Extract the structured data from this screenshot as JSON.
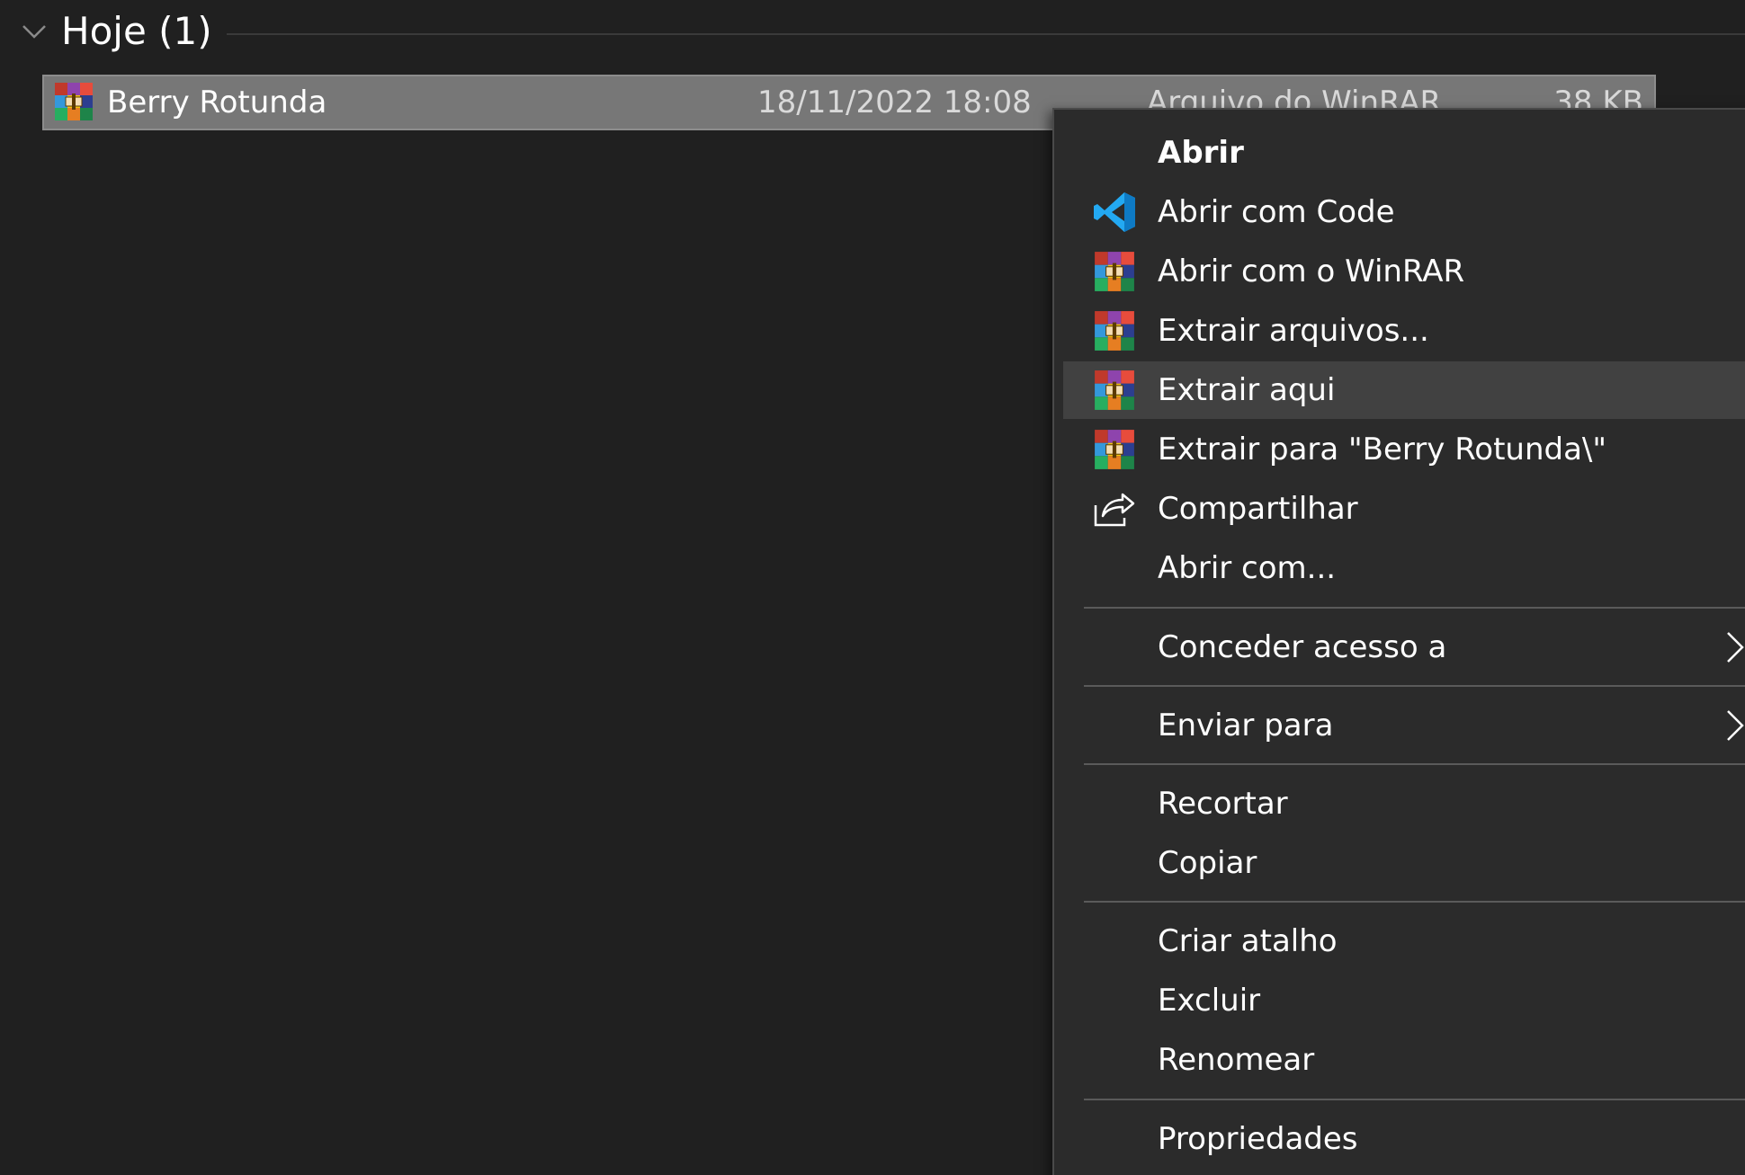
{
  "group": {
    "title": "Hoje (1)"
  },
  "file": {
    "name": "Berry Rotunda",
    "modified": "18/11/2022 18:08",
    "type": "Arquivo do WinRAR",
    "size": "38 KB",
    "icon": "winrar-archive-icon"
  },
  "menu": {
    "items": [
      {
        "label": "Abrir",
        "icon": "",
        "bold": true
      },
      {
        "label": "Abrir com Code",
        "icon": "vscode-icon"
      },
      {
        "label": "Abrir com o WinRAR",
        "icon": "winrar-icon"
      },
      {
        "label": "Extrair arquivos...",
        "icon": "winrar-icon"
      },
      {
        "label": "Extrair aqui",
        "icon": "winrar-icon",
        "hovered": true
      },
      {
        "label": "Extrair para \"Berry Rotunda\\\"",
        "icon": "winrar-icon"
      },
      {
        "label": "Compartilhar",
        "icon": "share-icon"
      },
      {
        "label": "Abrir com...",
        "icon": ""
      },
      {
        "label": "Conceder acesso a",
        "icon": "",
        "submenu": true
      },
      {
        "label": "Enviar para",
        "icon": "",
        "submenu": true
      },
      {
        "label": "Recortar",
        "icon": ""
      },
      {
        "label": "Copiar",
        "icon": ""
      },
      {
        "label": "Criar atalho",
        "icon": ""
      },
      {
        "label": "Excluir",
        "icon": ""
      },
      {
        "label": "Renomear",
        "icon": ""
      },
      {
        "label": "Propriedades",
        "icon": ""
      }
    ]
  },
  "colors": {
    "background": "#202020",
    "menu_background": "#2b2b2b",
    "menu_hover": "#414141",
    "selected_row": "#777777",
    "vscode_blue": "#23a9f2"
  }
}
